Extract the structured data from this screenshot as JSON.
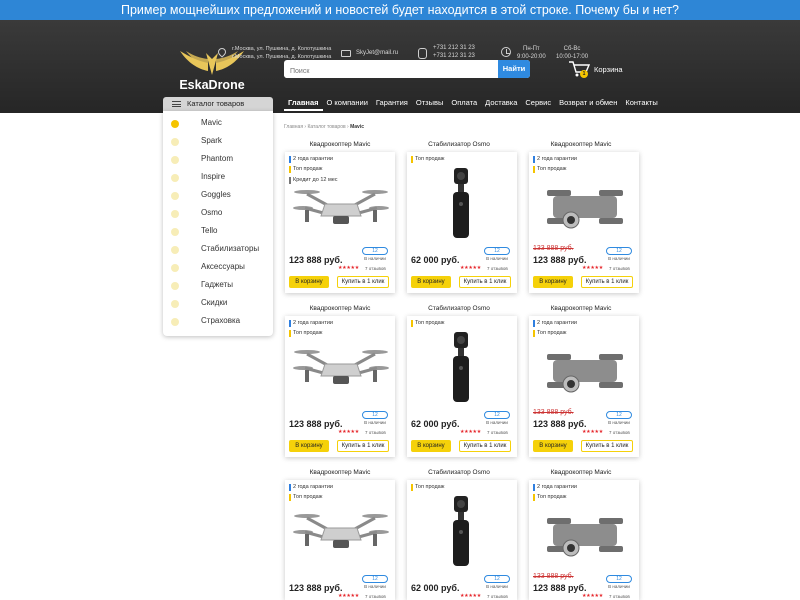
{
  "promo": {
    "text": "Пример мощнейших предложений и новостей будет находится в этой строке. Почему бы и нет?"
  },
  "header": {
    "logo_text": "EskaDrone",
    "address_1": "г.Москва, ул. Пушкина, д. Колотушкина",
    "address_2": "г.Москва, ул. Пушкина, д. Колотушкина",
    "email": "SkyJet@mail.ru",
    "phone_1": "+731 212 31 23",
    "phone_2": "+731 212 31 23",
    "weekday_label": "Пн-Пт",
    "weekday_hours": "9:00-20:00",
    "weekend_label": "Сб-Вс",
    "weekend_hours": "10:00-17:00",
    "search_placeholder": "Поиск",
    "search_button": "Найти",
    "cart_label": "Корзина",
    "cart_count": "1"
  },
  "catalog": {
    "button_label": "Каталог товаров",
    "items": [
      {
        "label": "Mavic"
      },
      {
        "label": "Spark"
      },
      {
        "label": "Phantom"
      },
      {
        "label": "Inspire"
      },
      {
        "label": "Goggles"
      },
      {
        "label": "Osmo"
      },
      {
        "label": "Tello"
      },
      {
        "label": "Стабилизаторы"
      },
      {
        "label": "Аксессуары"
      },
      {
        "label": "Гаджеты"
      },
      {
        "label": "Скидки"
      },
      {
        "label": "Страховка"
      }
    ]
  },
  "nav": {
    "items": [
      {
        "label": "Главная"
      },
      {
        "label": "О компании"
      },
      {
        "label": "Гарантия"
      },
      {
        "label": "Отзывы"
      },
      {
        "label": "Оплата"
      },
      {
        "label": "Доставка"
      },
      {
        "label": "Сервис"
      },
      {
        "label": "Возврат и обмен"
      },
      {
        "label": "Контакты"
      }
    ]
  },
  "breadcrumb": {
    "path": "Главная › Каталог товаров › ",
    "current": "Mavic"
  },
  "products": {
    "mavic": {
      "title": "Квадрокоптер Mavic",
      "tag_warranty": "2 года гарантии",
      "tag_top": "Топ продаж",
      "tag_credit": "Кредит до 12 мес",
      "price": "123 888 руб.",
      "stock_count": "12",
      "stock_label": "В наличии",
      "stars": "★★★★★",
      "rating": 4,
      "reviews": "7 отзывов",
      "to_cart": "В корзину",
      "one_click": "Купить в 1 клик"
    },
    "osmo": {
      "title": "Стабилизатор Osmo",
      "tag_top": "Топ продаж",
      "price": "62 000 руб.",
      "stock_count": "12",
      "stock_label": "В наличии",
      "stars": "★★★★★",
      "rating": 4,
      "reviews": "7 отзывов",
      "to_cart": "В корзину",
      "one_click": "Купить в 1 клик"
    },
    "mavic2": {
      "title": "Квадрокоптер Mavic",
      "tag_warranty": "2 года гарантии",
      "tag_top": "Топ продаж",
      "old_price": "133 888 руб.",
      "price": "123 888 руб.",
      "stock_count": "12",
      "stock_label": "В наличии",
      "stars": "★★★★★",
      "rating": 4,
      "reviews": "7 отзывов",
      "to_cart": "В корзину",
      "one_click": "Купить в 1 клик"
    }
  },
  "colors": {
    "accent_yellow": "#f5d10a",
    "accent_blue": "#2f8ae0",
    "header_dark": "#2b2b2b"
  }
}
